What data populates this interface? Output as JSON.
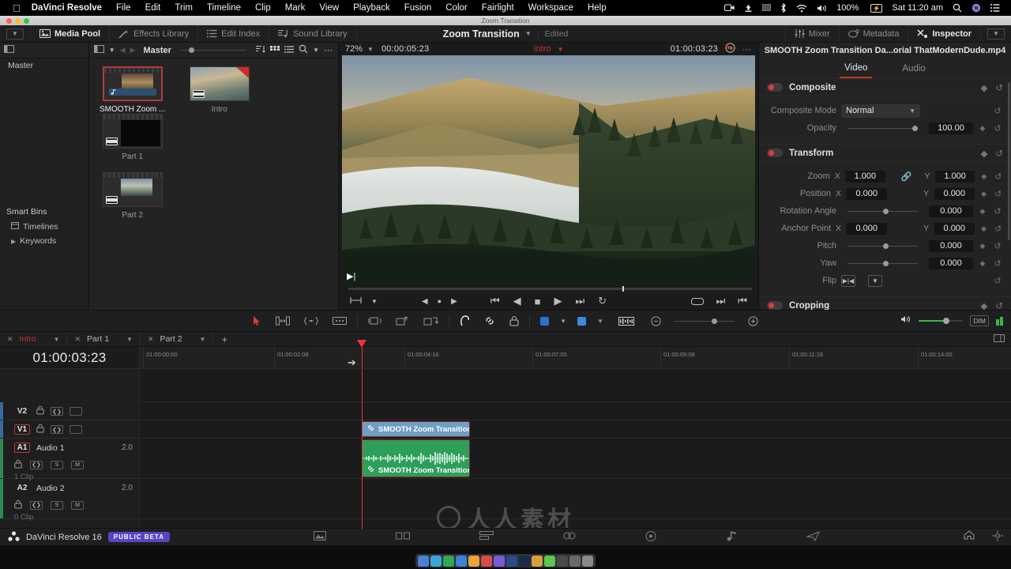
{
  "macbar": {
    "brand": "DaVinci Resolve",
    "menus": [
      "File",
      "Edit",
      "Trim",
      "Timeline",
      "Clip",
      "Mark",
      "View",
      "Playback",
      "Fusion",
      "Color",
      "Fairlight",
      "Workspace",
      "Help"
    ],
    "battery_percent": "100%",
    "clock": "Sat 11:20 am",
    "status_icons": [
      "screen-record-icon",
      "airdrop-icon",
      "displays-icon",
      "bluetooth-icon",
      "wifi-icon",
      "volume-icon"
    ],
    "right_icons": [
      "search-icon",
      "siri-icon",
      "control-center-icon"
    ]
  },
  "window": {
    "title": "Zoom Transition"
  },
  "toolbar": {
    "left_caret": "chevron-down-icon",
    "buttons": [
      {
        "label": "Media Pool",
        "icon": "media-pool-icon",
        "active": true
      },
      {
        "label": "Effects Library",
        "icon": "magic-wand-icon",
        "active": false
      },
      {
        "label": "Edit Index",
        "icon": "list-icon",
        "active": false
      },
      {
        "label": "Sound Library",
        "icon": "sound-library-icon",
        "active": false
      }
    ],
    "project_title": "Zoom Transition",
    "project_caret": "chevron-down-icon",
    "edited_status": "Edited",
    "right_buttons": [
      {
        "label": "Mixer",
        "icon": "mixer-icon",
        "active": false
      },
      {
        "label": "Metadata",
        "icon": "metadata-icon",
        "active": false
      },
      {
        "label": "Inspector",
        "icon": "inspector-icon",
        "active": true
      }
    ]
  },
  "bins": {
    "header_icon": "panel-toggle-icon",
    "master_label": "Master",
    "smart_bins_title": "Smart Bins",
    "items": [
      {
        "label": "Timelines",
        "icon": "timeline-icon"
      },
      {
        "label": "Keywords",
        "icon": "chevron-right-icon"
      }
    ]
  },
  "pool": {
    "breadcrumb": "Master",
    "toolbar_icons": [
      "sort-icon",
      "grid-view-icon",
      "list-view-icon",
      "search-icon",
      "chevron-down-icon",
      "more-options-icon"
    ],
    "clips": [
      {
        "label": "SMOOTH Zoom ...",
        "type": "audio",
        "selected": true
      },
      {
        "label": "Intro",
        "type": "video",
        "selected": false
      },
      {
        "label": "Part 1",
        "type": "video-dark",
        "selected": false
      },
      {
        "label": "Part 2",
        "type": "video",
        "selected": false
      }
    ]
  },
  "viewer": {
    "zoom_level": "72%",
    "source_timecode": "00:00:05:23",
    "timeline_name": "Intro",
    "record_timecode": "01:00:03:23",
    "color_icon": "color-wheel-icon",
    "more_icon": "more-options-icon",
    "transport": [
      "skip-to-start-icon",
      "play-reverse-icon",
      "stop-icon",
      "play-icon",
      "skip-to-end-icon",
      "loop-icon"
    ],
    "left_icons": [
      "aspect-icon",
      "chevron-down-icon",
      "prev-marker-icon",
      "marker-dot-icon",
      "next-marker-icon"
    ],
    "right_icons": [
      "widescreen-icon",
      "next-clip-icon",
      "first-clip-icon"
    ]
  },
  "inspector": {
    "title": "SMOOTH Zoom Transition Da...orial  ThatModernDude.mp4",
    "more_icon": "more-options-icon",
    "tabs": [
      {
        "label": "Video",
        "active": true
      },
      {
        "label": "Audio",
        "active": false
      }
    ],
    "sections": [
      {
        "name": "Composite",
        "enabled": true,
        "rows": [
          {
            "label": "Composite Mode",
            "type": "dropdown",
            "value": "Normal"
          },
          {
            "label": "Opacity",
            "type": "slider",
            "value": "100.00"
          }
        ]
      },
      {
        "name": "Transform",
        "enabled": true,
        "rows": [
          {
            "label": "Zoom",
            "type": "xy",
            "x": "1.000",
            "y": "1.000",
            "link": true
          },
          {
            "label": "Position",
            "type": "xy",
            "x": "0.000",
            "y": "0.000",
            "link": false
          },
          {
            "label": "Rotation Angle",
            "type": "slider",
            "value": "0.000"
          },
          {
            "label": "Anchor Point",
            "type": "xy",
            "x": "0.000",
            "y": "0.000",
            "link": false
          },
          {
            "label": "Pitch",
            "type": "slider",
            "value": "0.000"
          },
          {
            "label": "Yaw",
            "type": "slider",
            "value": "0.000"
          },
          {
            "label": "Flip",
            "type": "flip"
          }
        ]
      },
      {
        "name": "Cropping",
        "enabled": true,
        "rows": []
      }
    ]
  },
  "edit_toolbar": {
    "tools": [
      "selection-arrow-icon",
      "trim-edit-icon",
      "dynamic-trim-icon",
      "blade-edit-icon",
      "insert-clip-icon",
      "overwrite-clip-icon",
      "replace-clip-icon",
      "snapping-icon",
      "linked-selection-icon",
      "lock-icon",
      "flag-icon",
      "chevron-down-icon",
      "marker-icon",
      "chevron-down-icon",
      "audio-waveform-icon",
      "zoom-out-icon",
      "zoom-in-icon"
    ],
    "right": {
      "speaker_icon": "speaker-icon",
      "dim_label": "DIM",
      "meter_icon": "audio-meter-icon"
    }
  },
  "timeline_tabs": {
    "tabs": [
      {
        "label": "Intro",
        "active": true
      },
      {
        "label": "Part 1",
        "active": false
      },
      {
        "label": "Part 2",
        "active": false
      }
    ],
    "add_label": "+",
    "right_icon": "timeline-view-options-icon"
  },
  "timeline": {
    "current_timecode": "01:00:03:23",
    "ruler_ticks": [
      "01:00:00:00",
      "01:00:02:08",
      "01:00:04:16",
      "01:00:07:00",
      "01:00:09:08",
      "01:00:11:16",
      "01:00:14:00"
    ],
    "playhead_timecode": "01:00:03:23",
    "tracks": [
      {
        "id": "V2",
        "type": "video",
        "selected": false,
        "icons": [
          "lock-icon",
          "auto-track-icon",
          "video-enable-icon"
        ]
      },
      {
        "id": "V1",
        "type": "video",
        "selected": true,
        "icons": [
          "lock-icon",
          "auto-track-icon",
          "video-enable-icon"
        ]
      },
      {
        "id": "A1",
        "type": "audio",
        "name": "Audio 1",
        "channels": "2.0",
        "selected": true,
        "icons": [
          "lock-icon",
          "auto-track-icon"
        ],
        "solo": "S",
        "mute": "M",
        "clip_count": "1 Clip"
      },
      {
        "id": "A2",
        "type": "audio",
        "name": "Audio 2",
        "channels": "2.0",
        "selected": false,
        "icons": [
          "lock-icon",
          "auto-track-icon"
        ],
        "solo": "S",
        "mute": "M",
        "clip_count": "0 Clip"
      }
    ],
    "clips": [
      {
        "track": "V1",
        "label": "SMOOTH Zoom Transition ...",
        "icon": "link-icon",
        "color": "#6f9fc4"
      },
      {
        "track": "A1",
        "label": "SMOOTH Zoom Transition ...",
        "icon": "link-icon",
        "color": "#2e9e5b"
      }
    ]
  },
  "footer": {
    "app_name": "DaVinci Resolve 16",
    "badge": "PUBLIC BETA",
    "pages": [
      "media-page-icon",
      "cut-page-icon",
      "edit-page-icon",
      "fusion-page-icon",
      "color-page-icon",
      "fairlight-page-icon",
      "deliver-page-icon"
    ],
    "right_icons": [
      "home-icon",
      "settings-icon"
    ]
  },
  "watermark": {
    "text": "人人素材"
  },
  "colors": {
    "accent_red": "#c0392b",
    "video_clip": "#6f9fc4",
    "audio_clip": "#2e9e5b",
    "beta_badge": "#5b43c6",
    "meter_green": "#3cb54a"
  }
}
